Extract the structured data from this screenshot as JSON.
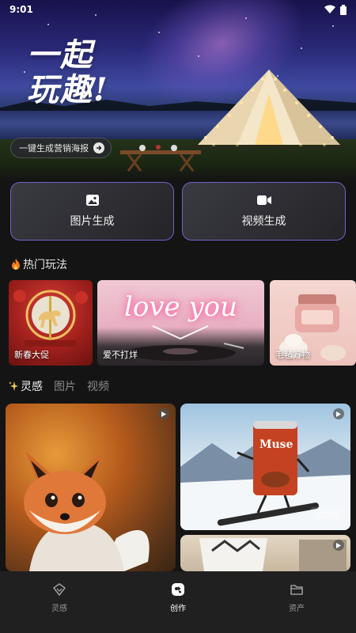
{
  "status": {
    "time": "9:01",
    "icons": [
      "wifi-icon",
      "battery-icon"
    ]
  },
  "hero": {
    "title_line1": "一起",
    "title_line2": "玩趣!",
    "poster_button": "一键生成营销海报"
  },
  "generate": {
    "image_label": "图片生成",
    "video_label": "视频生成"
  },
  "hot": {
    "title": "热门玩法",
    "cards": [
      {
        "label": "新春大促"
      },
      {
        "label": "爱不打烊",
        "neon_text": "love you"
      },
      {
        "label": "毛毡万物"
      }
    ]
  },
  "feed_tabs": {
    "items": [
      "灵感",
      "图片",
      "视频"
    ],
    "active": "灵感"
  },
  "feed": {
    "cards": [
      {
        "subject": "fox"
      },
      {
        "subject": "muse-can",
        "can_text": "Muse",
        "watermark": "试同款"
      },
      {
        "subject": "paper-cup"
      }
    ]
  },
  "bottom_nav": {
    "items": [
      {
        "label": "灵感",
        "icon": "tag-icon"
      },
      {
        "label": "创作",
        "icon": "create-icon"
      },
      {
        "label": "资产",
        "icon": "folder-icon"
      }
    ],
    "active": "创作"
  },
  "colors": {
    "accent_border": "#6e63c8",
    "background": "#141414",
    "nav_bg": "#202020"
  }
}
